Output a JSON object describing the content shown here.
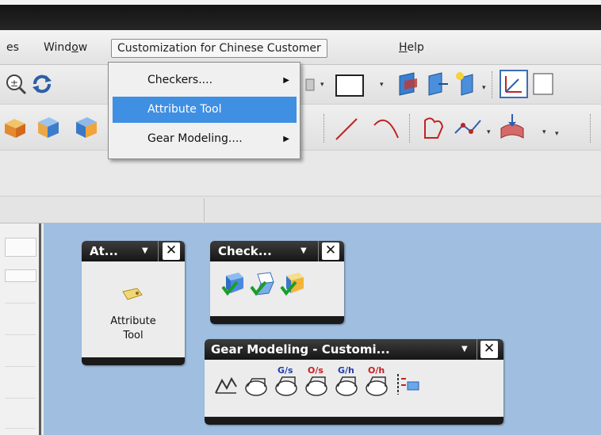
{
  "menubar": {
    "items": [
      {
        "label": "es"
      },
      {
        "label": "Window"
      },
      {
        "label": "Customization for Chinese Customer"
      },
      {
        "label": "Help"
      }
    ]
  },
  "dropdown": {
    "items": [
      {
        "label": "Checkers....",
        "submenu": true
      },
      {
        "label": "Attribute Tool",
        "submenu": false,
        "selected": true
      },
      {
        "label": "Gear Modeling....",
        "submenu": true
      }
    ]
  },
  "palettes": {
    "attribute": {
      "title": "At...",
      "tool_label_line1": "Attribute",
      "tool_label_line2": "Tool"
    },
    "checkers": {
      "title": "Check..."
    },
    "gear": {
      "title": "Gear Modeling - Customi...",
      "icon_labels": [
        "G/s",
        "O/s",
        "G/h",
        "O/h"
      ]
    }
  },
  "colors": {
    "menu_highlight": "#3f8fe3",
    "workspace": "#a0bfe0",
    "palette_header": "#1e1e1e"
  }
}
